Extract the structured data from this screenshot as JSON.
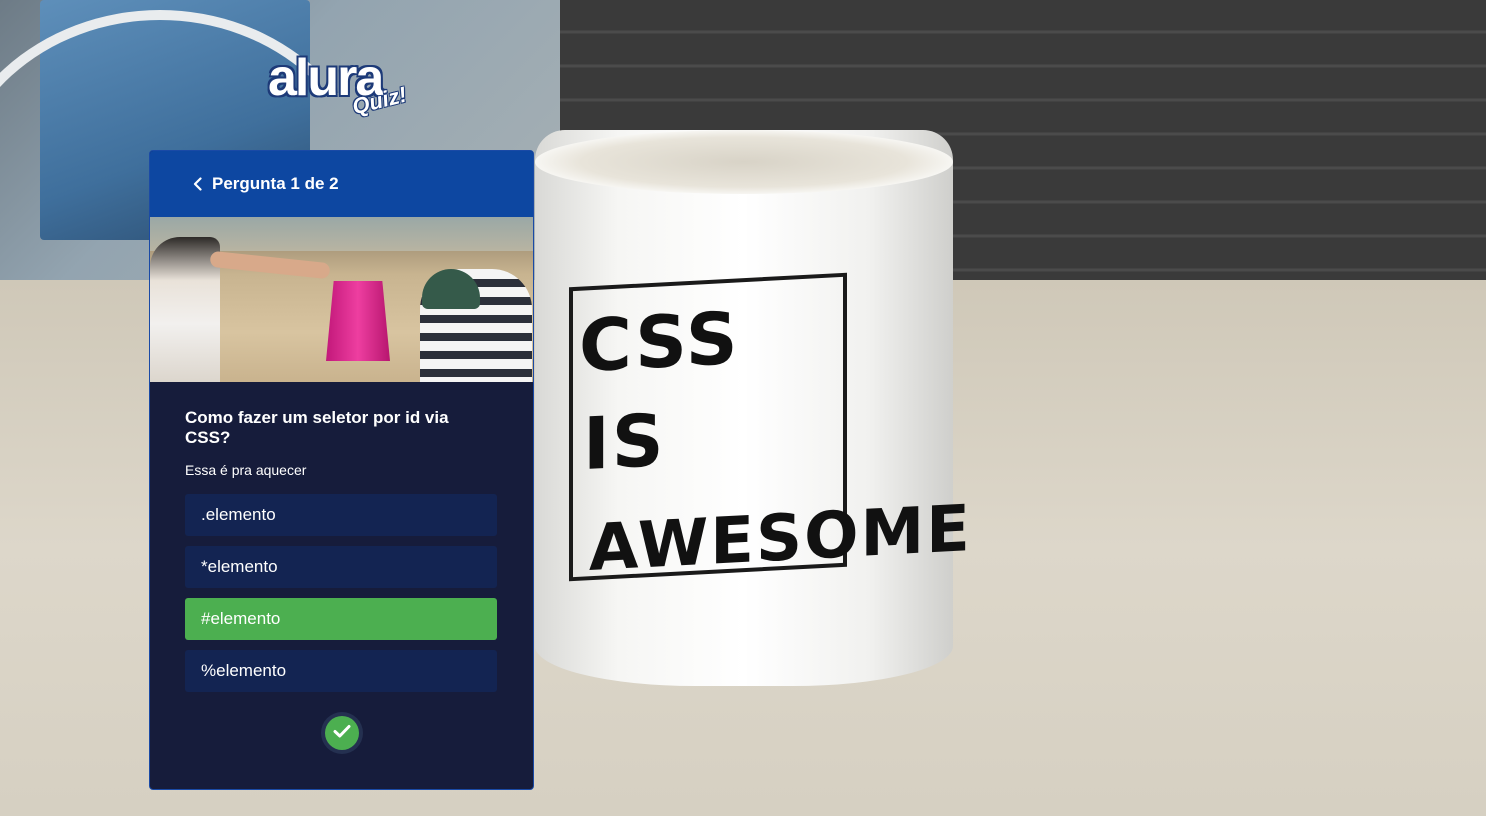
{
  "logo": {
    "main": "alura",
    "sub": "Quiz!"
  },
  "quiz": {
    "header": "Pergunta 1 de 2",
    "question": "Como fazer um seletor por id via CSS?",
    "description": "Essa é pra aquecer",
    "options": [
      {
        "label": ".elemento",
        "selected": false
      },
      {
        "label": "*elemento",
        "selected": false
      },
      {
        "label": "#elemento",
        "selected": true
      },
      {
        "label": "%elemento",
        "selected": false
      }
    ],
    "icons": {
      "back": "chevron-left-icon",
      "confirm": "check-icon"
    }
  },
  "background": {
    "mug_text": [
      "CSS",
      "IS",
      "AWESOME"
    ]
  },
  "colors": {
    "header": "#0d47a1",
    "card": "#161c3b",
    "option": "#132452",
    "selected": "#4caf50"
  }
}
